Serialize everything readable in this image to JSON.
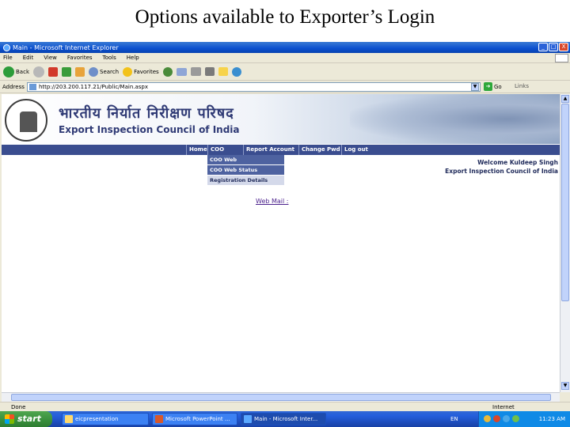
{
  "slide": {
    "title": "Options  available to Exporter’s Login"
  },
  "window": {
    "title": "Main - Microsoft Internet Explorer",
    "controls": [
      "_",
      "□",
      "X"
    ]
  },
  "menu": [
    "File",
    "Edit",
    "View",
    "Favorites",
    "Tools",
    "Help"
  ],
  "toolbar": {
    "back_label": "Back",
    "search_label": "Search",
    "favorites_label": "Favorites"
  },
  "addressbar": {
    "label": "Address",
    "url": "http://203.200.117.21/Public/Main.aspx",
    "go_label": "Go",
    "links_label": "Links"
  },
  "site": {
    "hindi_title": "भारतीय निर्यात निरीक्षण परिषद",
    "english_title": "Export Inspection Council of India",
    "nav": [
      "Home",
      "COO",
      "Report Account",
      "Change Pwd",
      "Log out"
    ],
    "coo_menu": [
      "COO Web",
      "COO Web Status",
      "Registration Details"
    ],
    "welcome_line1": "Welcome Kuldeep Singh",
    "welcome_line2": "Export Inspection Council of India",
    "webmail_label": "Web Mail :"
  },
  "status": {
    "left": "Done",
    "zone": "Internet"
  },
  "taskbar": {
    "start_label": "start",
    "items": [
      "eicpresentation",
      "Microsoft PowerPoint ...",
      "Main - Microsoft Inter..."
    ],
    "language": "EN",
    "clock": "11:23 AM"
  }
}
